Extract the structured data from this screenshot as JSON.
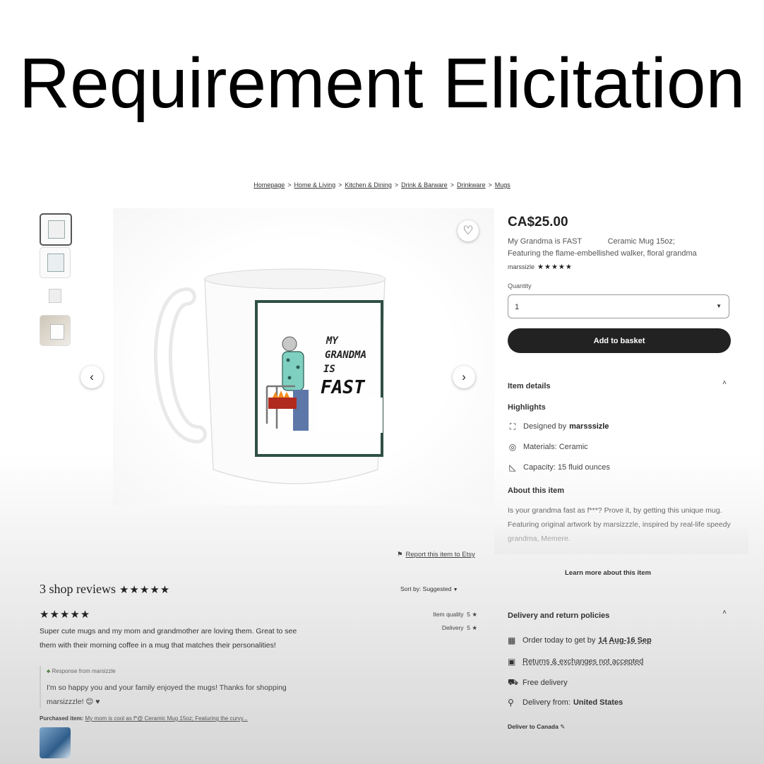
{
  "slide": {
    "title": "Requirement Elicitation"
  },
  "breadcrumb": [
    "Homepage",
    "Home & Living",
    "Kitchen & Dining",
    "Drink & Barware",
    "Drinkware",
    "Mugs"
  ],
  "breadcrumb_sep": ">",
  "mug": {
    "text_lines": [
      "MY",
      "GRANDMA",
      "IS",
      "FAST"
    ]
  },
  "product": {
    "price": "CA$25.00",
    "title_line1": "My Grandma is FAST            Ceramic Mug 15oz;",
    "title_line2": "Featuring the flame-embellished walker, floral grandma",
    "seller": "marssizle",
    "seller_stars": "★★★★★",
    "quantity_label": "Quantity",
    "quantity_value": "1",
    "add_to_basket": "Add to basket"
  },
  "item_details": {
    "heading": "Item details",
    "highlights_heading": "Highlights",
    "designed_by_prefix": "Designed by",
    "designer": "marsssizle",
    "materials": "Materials: Ceramic",
    "capacity": "Capacity: 15 fluid ounces",
    "about_heading": "About this item",
    "about_text": "Is your grandma fast as f***? Prove it, by getting this unique mug. Featuring original artwork by marsizzzle, inspired by real-life speedy grandma, Memere.",
    "learn_more": "Learn more about this item",
    "report": "Report this item to Etsy"
  },
  "reviews": {
    "title": "3 shop reviews",
    "title_stars": "★★★★★",
    "sort_by": "Sort by: Suggested",
    "review_stars": "★★★★★",
    "review_text": "Super cute mugs and my mom and grandmother are loving them. Great to see them with their morning coffee in a mug that matches their personalities!",
    "item_quality_label": "Item quality",
    "item_quality_value": "5",
    "delivery_label": "Delivery",
    "delivery_value": "5",
    "response_heading": "Response from marsizzle",
    "response_text": "I'm so happy you and your family enjoyed the mugs! Thanks for shopping marsizzzle! 😊 ♥",
    "purchased_label": "Purchased item:",
    "purchased_item": "My mom is cool as f*@ Ceramic Mug 15oz; Featuring the curvy..."
  },
  "delivery": {
    "heading": "Delivery and return policies",
    "order_prefix": "Order today to get by",
    "order_dates": "14 Aug-16 Sep",
    "returns": "Returns & exchanges not accepted",
    "free_delivery": "Free delivery",
    "from_prefix": "Delivery from:",
    "from_country": "United States",
    "deliver_to": "Deliver to Canada"
  },
  "icons": {
    "favorite": "heart-icon",
    "prev": "chevron-left-icon",
    "next": "chevron-right-icon",
    "designer": "designer-icon",
    "materials": "materials-icon",
    "capacity": "ruler-icon",
    "calendar": "calendar-icon",
    "returns": "returns-icon",
    "free_delivery": "truck-icon",
    "location": "location-pin-icon",
    "edit": "pencil-icon",
    "flag": "flag-icon"
  }
}
